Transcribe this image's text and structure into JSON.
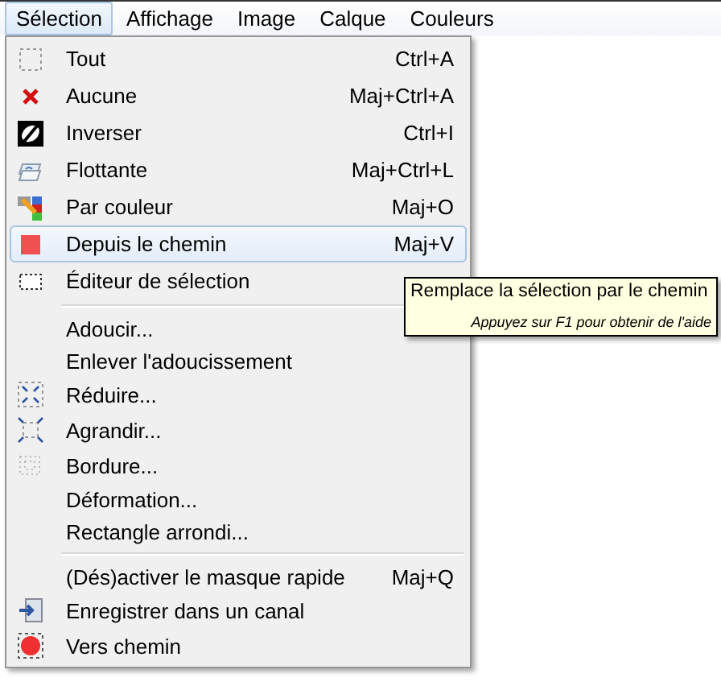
{
  "menubar": [
    {
      "label": "Sélection",
      "selected": true
    },
    {
      "label": "Affichage",
      "selected": false
    },
    {
      "label": "Image",
      "selected": false
    },
    {
      "label": "Calque",
      "selected": false
    },
    {
      "label": "Couleurs",
      "selected": false
    }
  ],
  "menu": {
    "groups": [
      [
        {
          "label": "Tout",
          "shortcut": "Ctrl+A",
          "selected": false
        },
        {
          "label": "Aucune",
          "shortcut": "Maj+Ctrl+A",
          "selected": false
        },
        {
          "label": "Inverser",
          "shortcut": "Ctrl+I",
          "selected": false
        },
        {
          "label": "Flottante",
          "shortcut": "Maj+Ctrl+L",
          "selected": false
        },
        {
          "label": "Par couleur",
          "shortcut": "Maj+O",
          "selected": false
        },
        {
          "label": "Depuis le chemin",
          "shortcut": "Maj+V",
          "selected": true
        },
        {
          "label": "Éditeur de sélection",
          "selected": false
        }
      ],
      [
        {
          "label": "Adoucir...",
          "selected": false
        },
        {
          "label": "Enlever l'adoucissement",
          "selected": false
        },
        {
          "label": "Réduire...",
          "selected": false
        },
        {
          "label": "Agrandir...",
          "selected": false
        },
        {
          "label": "Bordure...",
          "selected": false
        },
        {
          "label": "Déformation...",
          "selected": false
        },
        {
          "label": "Rectangle arrondi...",
          "selected": false
        }
      ],
      [
        {
          "label": "(Dés)activer le masque rapide",
          "shortcut": "Maj+Q",
          "selected": false
        },
        {
          "label": "Enregistrer dans un canal",
          "selected": false
        },
        {
          "label": "Vers chemin",
          "selected": false
        }
      ]
    ]
  },
  "tooltip": {
    "text": "Remplace la sélection par le chemin",
    "hint": "Appuyez sur F1 pour obtenir de l'aide"
  }
}
